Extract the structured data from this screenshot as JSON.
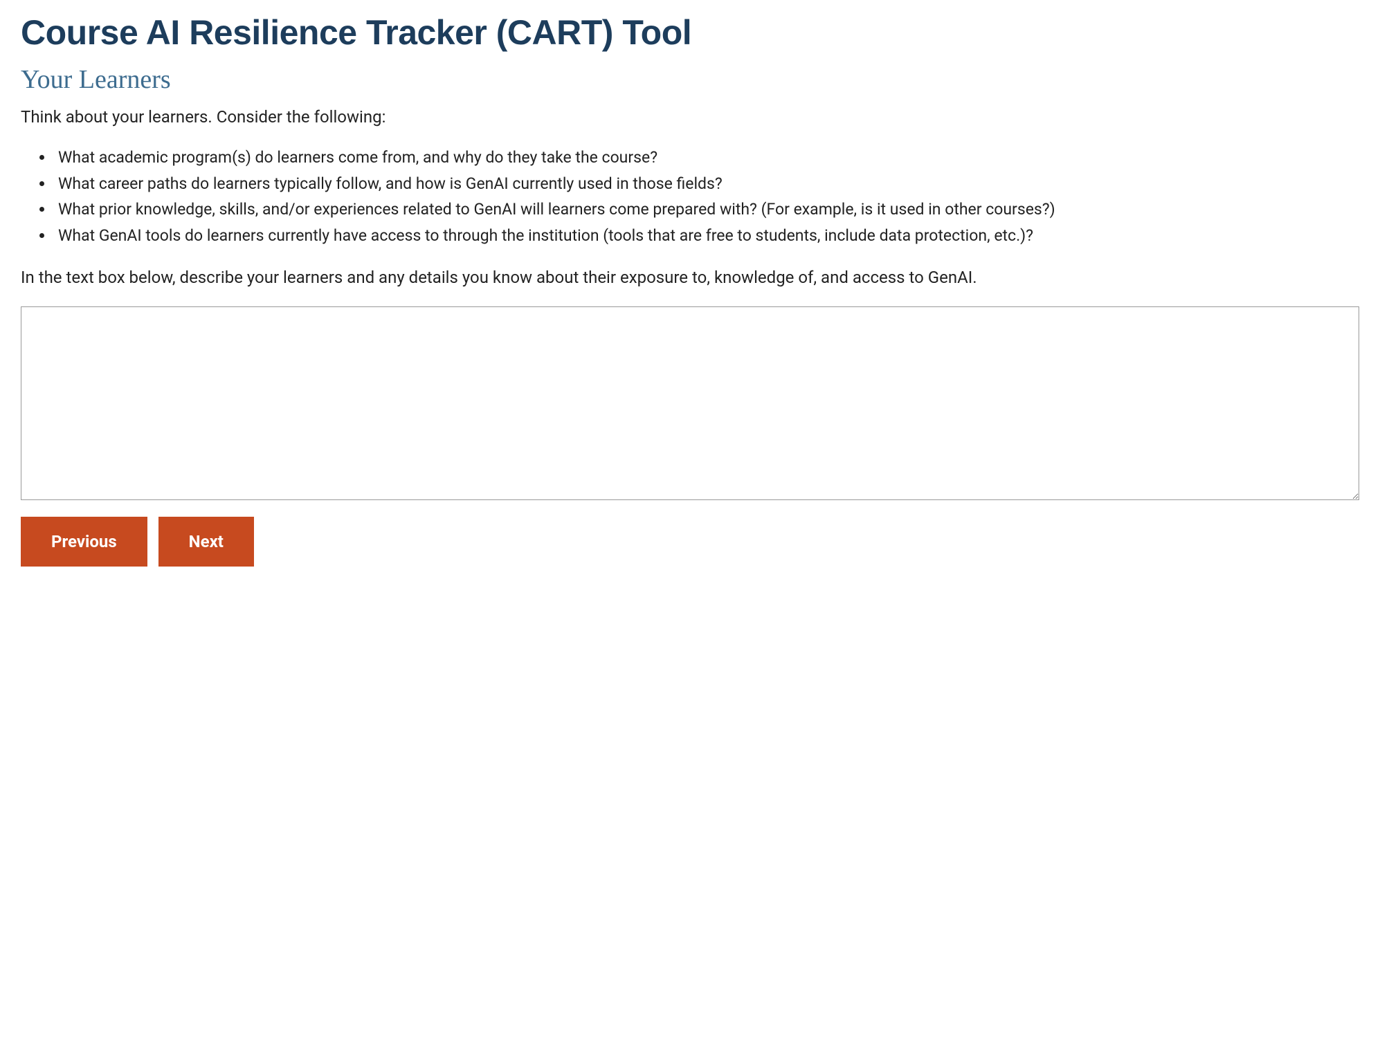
{
  "header": {
    "page_title": "Course AI Resilience Tracker (CART) Tool"
  },
  "section": {
    "title": "Your Learners",
    "intro": "Think about your learners. Consider the following:",
    "bullets": [
      "What academic program(s) do learners come from, and why do they take the course?",
      "What career paths do learners typically follow, and how is GenAI currently used in those fields?",
      "What prior knowledge, skills, and/or experiences related to GenAI will learners come prepared with? (For example, is it used in other courses?)",
      "What GenAI tools do learners currently have access to through the institution (tools that are free to students, include data protection, etc.)?"
    ],
    "instruction": "In the text box below, describe your learners and any details you know about their exposure to, knowledge of, and access to GenAI."
  },
  "form": {
    "textarea_value": ""
  },
  "nav": {
    "previous_label": "Previous",
    "next_label": "Next"
  },
  "colors": {
    "title_dark_blue": "#1d3d5c",
    "section_blue": "#3d6c8f",
    "button_orange": "#c74a1f"
  }
}
